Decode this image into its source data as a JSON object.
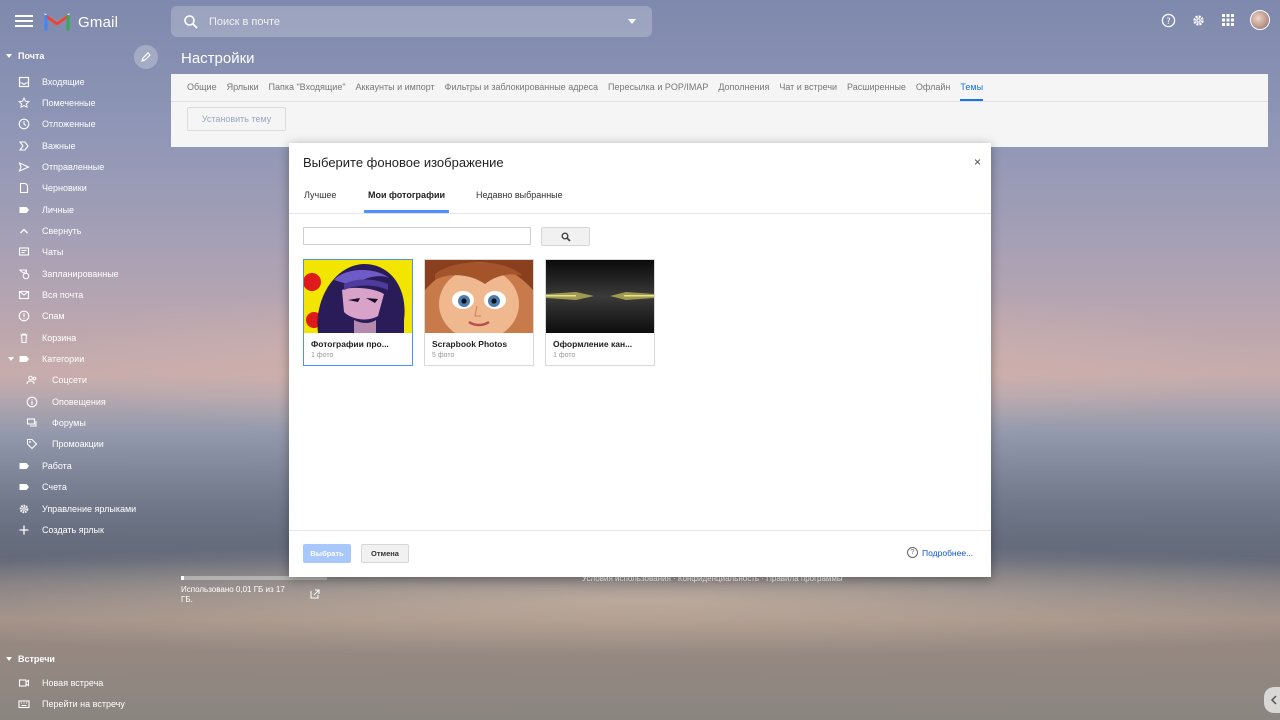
{
  "app": {
    "logo_text": "Gmail",
    "search_placeholder": "Поиск в почте"
  },
  "sidebar": {
    "mail_section": "Почта",
    "items": [
      {
        "label": "Входящие",
        "icon": "inbox-icon"
      },
      {
        "label": "Помеченные",
        "icon": "star-icon"
      },
      {
        "label": "Отложенные",
        "icon": "clock-icon"
      },
      {
        "label": "Важные",
        "icon": "important-icon"
      },
      {
        "label": "Отправленные",
        "icon": "send-icon"
      },
      {
        "label": "Черновики",
        "icon": "draft-icon"
      },
      {
        "label": "Личные",
        "icon": "label-icon"
      },
      {
        "label": "Свернуть",
        "icon": "chevron-up-icon"
      },
      {
        "label": "Чаты",
        "icon": "chat-icon"
      },
      {
        "label": "Запланированные",
        "icon": "scheduled-icon"
      },
      {
        "label": "Вся почта",
        "icon": "all-mail-icon"
      },
      {
        "label": "Спам",
        "icon": "spam-icon"
      },
      {
        "label": "Корзина",
        "icon": "trash-icon"
      },
      {
        "label": "Категории",
        "icon": "label-icon"
      },
      {
        "label": "Соцсети",
        "icon": "people-icon"
      },
      {
        "label": "Оповещения",
        "icon": "info-icon"
      },
      {
        "label": "Форумы",
        "icon": "forum-icon"
      },
      {
        "label": "Промоакции",
        "icon": "tag-icon"
      },
      {
        "label": "Работа",
        "icon": "label-icon"
      },
      {
        "label": "Счета",
        "icon": "label-icon"
      },
      {
        "label": "Управление ярлыками",
        "icon": "gear-icon"
      },
      {
        "label": "Создать ярлык",
        "icon": "plus-icon"
      }
    ],
    "meet_section": "Встречи",
    "meet_items": [
      {
        "label": "Новая встреча",
        "icon": "video-icon"
      },
      {
        "label": "Перейти на встречу",
        "icon": "keyboard-icon"
      }
    ]
  },
  "settings": {
    "title": "Настройки",
    "tabs": [
      "Общие",
      "Ярлыки",
      "Папка \"Входящие\"",
      "Аккаунты и импорт",
      "Фильтры и заблокированные адреса",
      "Пересылка и POP/IMAP",
      "Дополнения",
      "Чат и встречи",
      "Расширенные",
      "Офлайн",
      "Темы"
    ],
    "active_tab": "Темы",
    "set_theme_button": "Установить тему"
  },
  "footer": {
    "storage_text": "Использовано 0,01 ГБ из 17 ГБ.",
    "storage_fraction": 0.0006,
    "links": "Условия использования · Конфиденциальность · Правила программы"
  },
  "modal": {
    "title": "Выберите фоновое изображение",
    "close": "×",
    "tabs": [
      "Лучшее",
      "Мои фотографии",
      "Недавно выбранные"
    ],
    "active_tab": "Мои фотографии",
    "albums": [
      {
        "name": "Фотографии про...",
        "count": "1 фото"
      },
      {
        "name": "Scrapbook Photos",
        "count": "5 фото"
      },
      {
        "name": "Оформление кан...",
        "count": "1 фото"
      }
    ],
    "select_button": "Выбрать",
    "cancel_button": "Отмена",
    "more_link": "Подробнее..."
  }
}
